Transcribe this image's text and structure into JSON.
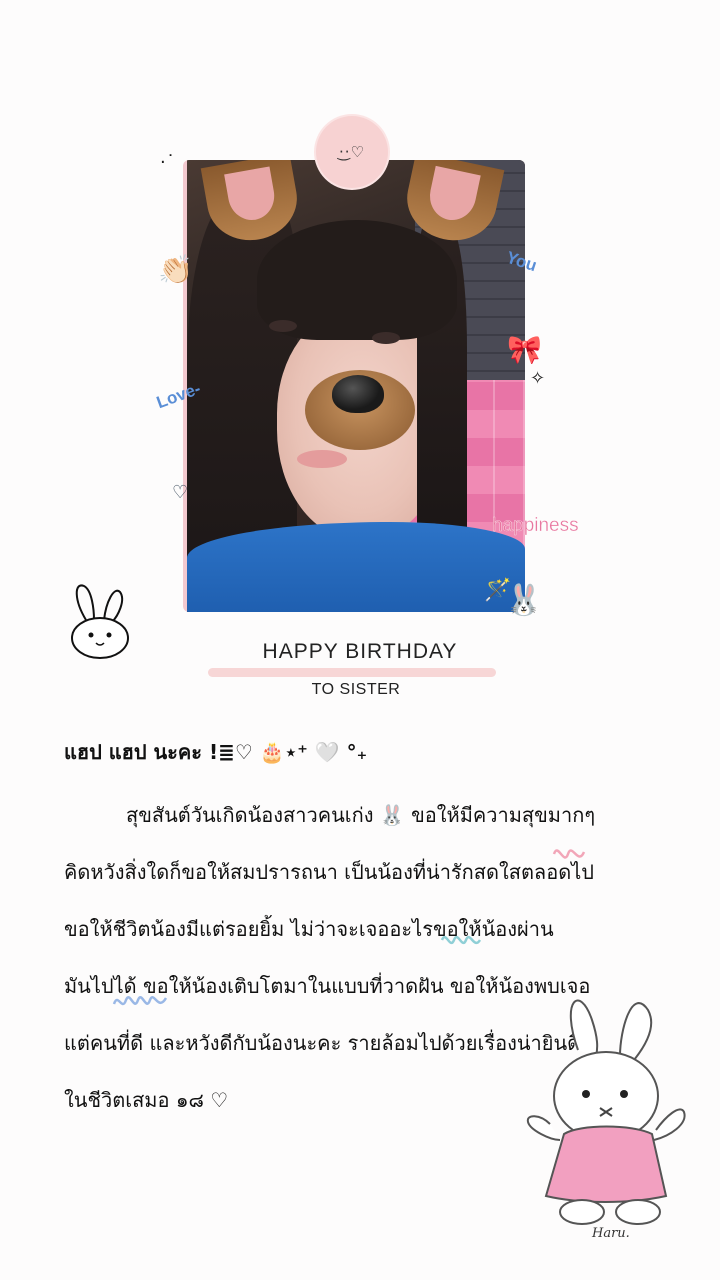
{
  "card": {
    "title": "HAPPY BIRTHDAY",
    "subtitle": "TO SISTER",
    "badge_face": "·͜·♡"
  },
  "photo_tags": {
    "you": "You",
    "love": "Love-",
    "happiness": "happiness"
  },
  "stickers": {
    "clap": "👏🏻",
    "bow": "🎀",
    "sparkle": "✧",
    "heart_outline": "♡",
    "wand": "🪄",
    "bunny_face": "🐰",
    "top_dots": "· ͘"
  },
  "message": {
    "greeting": "แฮป แฮป นะคะ !≣♡ 🎂⋆⁺ 🤍 °₊",
    "lines": [
      "สุขสันต์วันเกิดน้องสาวคนเก่ง 🐰 ขอให้มีความสุขมากๆ",
      "คิดหวังสิ่งใดก็ขอให้สมปรารถนา เป็นน้องที่น่ารักสดใสตลอดไป",
      "ขอให้ชีวิตน้องมีแต่รอยยิ้ม ไม่ว่าจะเจออะไรขอให้น้องผ่าน",
      "มันไปได้ ขอให้น้องเติบโตมาในแบบที่วาดฝัน ขอให้น้องพบเจอ",
      "แต่คนที่ดี และหวังดีกับน้องนะคะ รายล้อมไปด้วยเรื่องน่ายินดี",
      "ในชีวิตเสมอ ๑๘ ♡"
    ]
  },
  "signature": "Haru.",
  "colors": {
    "accent_pink": "#f7d6d6",
    "tag_blue": "#5a8ed6",
    "tag_pink": "#e8779f"
  }
}
